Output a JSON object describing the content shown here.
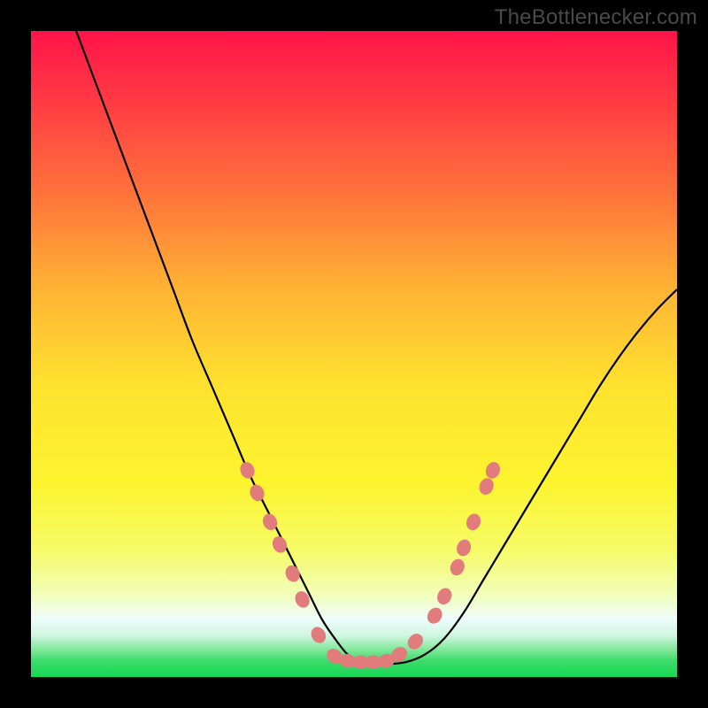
{
  "watermark": "TheBottlenecker.com",
  "chart_data": {
    "type": "line",
    "title": "",
    "xlabel": "",
    "ylabel": "",
    "xlim": [
      0,
      100
    ],
    "ylim": [
      0,
      100
    ],
    "background_gradient_stops": [
      {
        "offset": 0.0,
        "color": "#ff1449"
      },
      {
        "offset": 0.1,
        "color": "#ff3744"
      },
      {
        "offset": 0.25,
        "color": "#ff723b"
      },
      {
        "offset": 0.4,
        "color": "#ffb334"
      },
      {
        "offset": 0.55,
        "color": "#ffe22f"
      },
      {
        "offset": 0.7,
        "color": "#fcf42f"
      },
      {
        "offset": 0.8,
        "color": "#f6fb65"
      },
      {
        "offset": 0.87,
        "color": "#f2feb6"
      },
      {
        "offset": 0.91,
        "color": "#eefcfc"
      },
      {
        "offset": 0.935,
        "color": "#d0f7e2"
      },
      {
        "offset": 0.955,
        "color": "#8ce9a2"
      },
      {
        "offset": 0.975,
        "color": "#3ddc6a"
      },
      {
        "offset": 1.0,
        "color": "#17d754"
      }
    ],
    "series": [
      {
        "name": "bottleneck-curve",
        "color": "#000000",
        "stroke_width": 2.2,
        "x": [
          7,
          10,
          13,
          16,
          19,
          22,
          25,
          28,
          31,
          34,
          37,
          40,
          43,
          45,
          47,
          49,
          51,
          53,
          55,
          58,
          61,
          64,
          67,
          70,
          73,
          76,
          79,
          82,
          85,
          88,
          91,
          94,
          97,
          100
        ],
        "y": [
          100,
          92,
          84,
          76,
          68,
          60,
          52,
          45,
          38,
          31,
          25,
          19,
          13,
          9,
          6,
          3.5,
          2.2,
          2,
          2,
          2.3,
          3.5,
          6,
          10,
          15,
          20,
          25,
          30,
          35,
          40,
          45,
          49.5,
          53.5,
          57,
          60
        ]
      }
    ],
    "markers": {
      "name": "curve-beads",
      "fill": "#e27c7c",
      "stroke": "#cf6a6a",
      "radius": 8.5,
      "points": [
        {
          "x": 33.5,
          "y": 32.0
        },
        {
          "x": 35.0,
          "y": 28.5
        },
        {
          "x": 37.0,
          "y": 24.0
        },
        {
          "x": 38.5,
          "y": 20.5
        },
        {
          "x": 40.5,
          "y": 16.0
        },
        {
          "x": 42.0,
          "y": 12.0
        },
        {
          "x": 44.5,
          "y": 6.5
        },
        {
          "x": 47.0,
          "y": 3.2
        },
        {
          "x": 49.0,
          "y": 2.5
        },
        {
          "x": 51.0,
          "y": 2.3
        },
        {
          "x": 53.0,
          "y": 2.3
        },
        {
          "x": 55.0,
          "y": 2.5
        },
        {
          "x": 57.0,
          "y": 3.5
        },
        {
          "x": 59.5,
          "y": 5.5
        },
        {
          "x": 62.5,
          "y": 9.5
        },
        {
          "x": 64.0,
          "y": 12.5
        },
        {
          "x": 66.0,
          "y": 17.0
        },
        {
          "x": 67.0,
          "y": 20.0
        },
        {
          "x": 68.5,
          "y": 24.0
        },
        {
          "x": 70.5,
          "y": 29.5
        },
        {
          "x": 71.5,
          "y": 32.0
        }
      ]
    }
  }
}
